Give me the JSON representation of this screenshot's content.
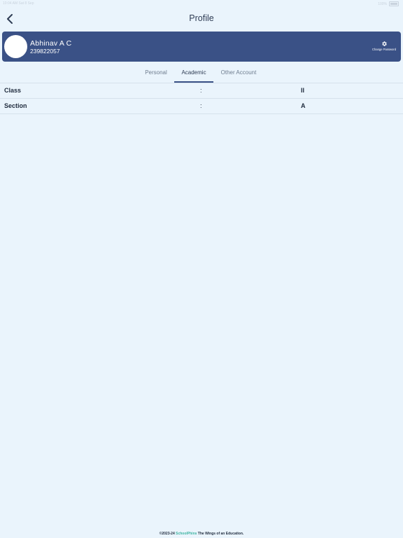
{
  "status_bar": {
    "left_text": "10:04 AM  Sat 8 Sep",
    "right_text": "100%"
  },
  "header": {
    "title": "Profile",
    "back_icon": "chevron-left-icon"
  },
  "profile_card": {
    "name": "Abhinav A C",
    "id": "239822057",
    "change_password_label": "Change Password",
    "change_password_icon": "gear-icon",
    "card_color": "#3a5186"
  },
  "tabs": [
    {
      "label": "Personal",
      "active": false
    },
    {
      "label": "Academic",
      "active": true
    },
    {
      "label": "Other Account",
      "active": false
    }
  ],
  "academic_rows": [
    {
      "label": "Class",
      "separator": ":",
      "value": "II"
    },
    {
      "label": "Section",
      "separator": ":",
      "value": "A"
    }
  ],
  "footer": {
    "prefix": "©2023-24",
    "brand": "SchoolPhins",
    "suffix": "The Wings of an Education."
  }
}
